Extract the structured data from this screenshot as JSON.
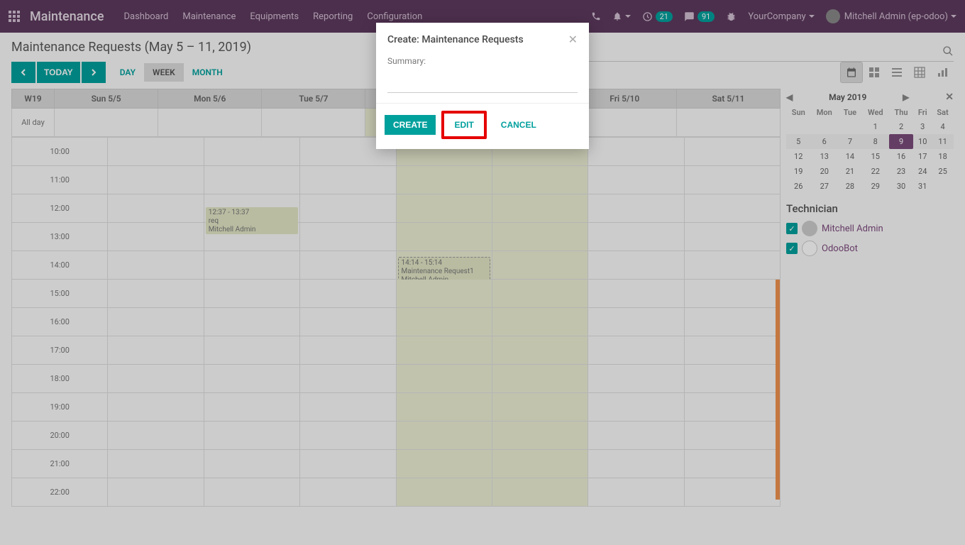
{
  "navbar": {
    "brand": "Maintenance",
    "links": [
      "Dashboard",
      "Maintenance",
      "Equipments",
      "Reporting",
      "Configuration"
    ],
    "activities_badge": "21",
    "discuss_badge": "91",
    "company": "YourCompany",
    "user": "Mitchell Admin (ep-odoo)"
  },
  "breadcrumb": "Maintenance Requests (May 5 – 11, 2019)",
  "toolbar": {
    "today": "TODAY",
    "ranges": {
      "day": "DAY",
      "week": "WEEK",
      "month": "MONTH"
    }
  },
  "calendar": {
    "week_label": "W19",
    "days": [
      "Sun 5/5",
      "Mon 5/6",
      "Tue 5/7",
      "",
      "",
      "Fri 5/10",
      "Sat 5/11"
    ],
    "all_day": "All day",
    "hours": [
      "10:00",
      "11:00",
      "12:00",
      "13:00",
      "14:00",
      "15:00",
      "16:00",
      "17:00",
      "18:00",
      "19:00",
      "20:00",
      "21:00",
      "22:00"
    ],
    "events": [
      {
        "time": "12:37 - 13:37",
        "title": "req",
        "owner": "Mitchell Admin"
      },
      {
        "time": "14:14 - 15:14",
        "title": "Maintenance Request1",
        "owner": "Mitchell Admin"
      }
    ]
  },
  "mini_cal": {
    "title": "May 2019",
    "dow": [
      "Sun",
      "Mon",
      "Tue",
      "Wed",
      "Thu",
      "Fri",
      "Sat"
    ],
    "weeks": [
      [
        "",
        "",
        "",
        "1",
        "2",
        "3",
        "4"
      ],
      [
        "5",
        "6",
        "7",
        "8",
        "9",
        "10",
        "11"
      ],
      [
        "12",
        "13",
        "14",
        "15",
        "16",
        "17",
        "18"
      ],
      [
        "19",
        "20",
        "21",
        "22",
        "23",
        "24",
        "25"
      ],
      [
        "26",
        "27",
        "28",
        "29",
        "30",
        "31",
        ""
      ]
    ]
  },
  "technicians": {
    "title": "Technician",
    "items": [
      "Mitchell Admin",
      "OdooBot"
    ]
  },
  "modal": {
    "title": "Create: Maintenance Requests",
    "summary_label": "Summary:",
    "summary_value": "",
    "create": "CREATE",
    "edit": "EDIT",
    "cancel": "CANCEL"
  }
}
